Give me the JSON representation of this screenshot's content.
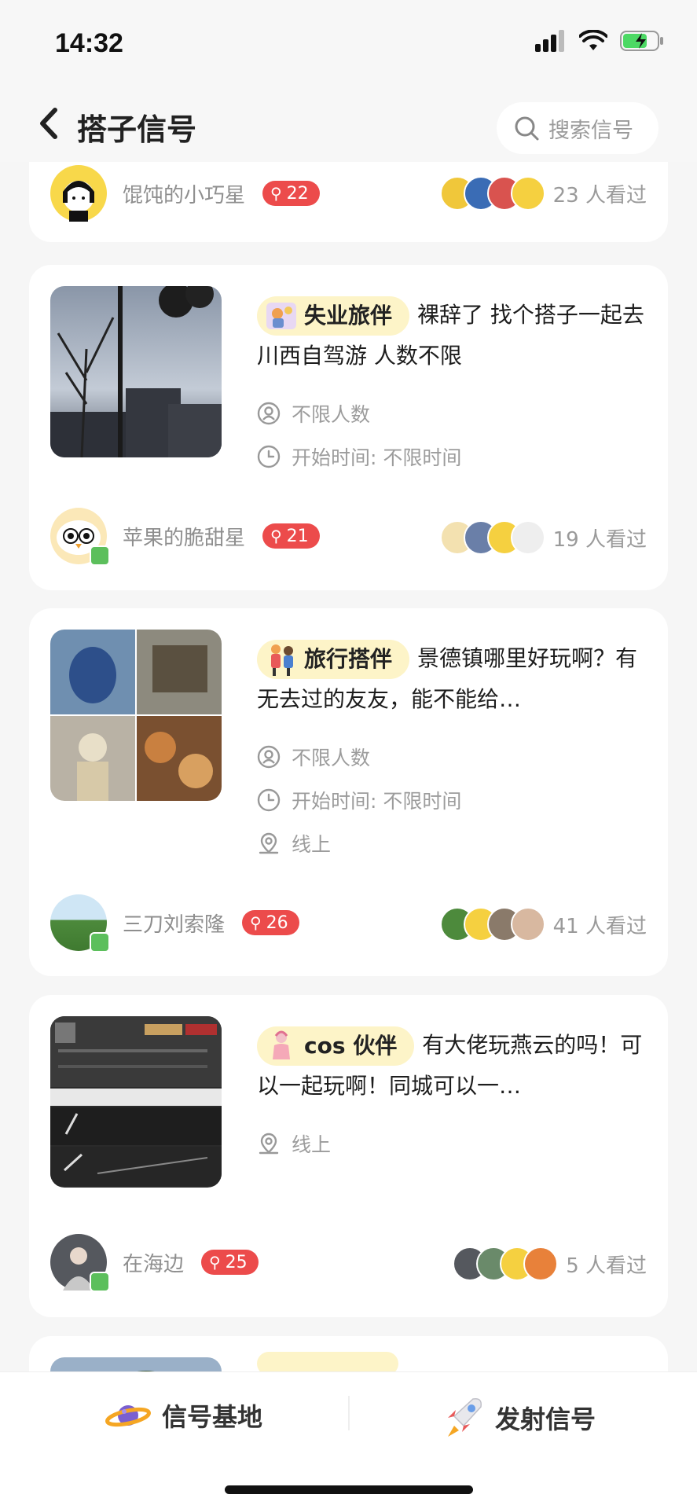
{
  "status_bar": {
    "time": "14:32"
  },
  "header": {
    "title": "搭子信号",
    "search_placeholder": "搜索信号"
  },
  "cards": [
    {
      "author": "馄饨的小巧星",
      "level": "22",
      "viewers": "23 人看过"
    },
    {
      "tag": "失业旅伴",
      "title": "裸辞了 找个搭子一起去川西自驾游 人数不限",
      "meta_people": "不限人数",
      "meta_time": "开始时间: 不限时间",
      "author": "苹果的脆甜星",
      "level": "21",
      "viewers": "19 人看过"
    },
    {
      "tag": "旅行搭伴",
      "title": "景德镇哪里好玩啊？有无去过的友友，能不能给…",
      "meta_people": "不限人数",
      "meta_time": "开始时间: 不限时间",
      "meta_location": "线上",
      "author": "三刀刘索隆",
      "level": "26",
      "viewers": "41 人看过"
    },
    {
      "tag": "cos 伙伴",
      "title": "有大佬玩燕云的吗！可以一起玩啊！同城可以一…",
      "meta_location": "线上",
      "author": "在海边",
      "level": "25",
      "viewers": "5 人看过"
    }
  ],
  "bottom_nav": {
    "base_label": "信号基地",
    "launch_label": "发射信号"
  },
  "colors": {
    "accent_red": "#ec4b4b",
    "tag_bg": "#fdf4c8",
    "page_bg": "#f6f6f6"
  }
}
